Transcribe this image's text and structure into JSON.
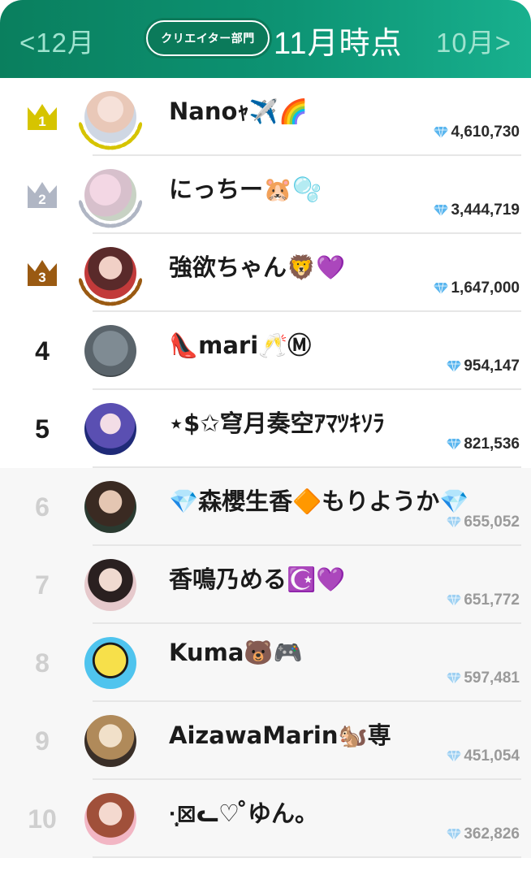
{
  "header": {
    "prev_label": "<12月",
    "category_label": "クリエイター部門",
    "current_label": "11月時点",
    "next_label": "10月>"
  },
  "colors": {
    "header_start": "#0a7f5e",
    "header_end": "#18b08e",
    "gold": "#d6c400",
    "silver": "#b0b6c4",
    "bronze": "#9a5a12",
    "gem": "#5ab6ef"
  },
  "rankings": [
    {
      "rank": "1",
      "name": "Nanoｬ✈️🌈",
      "score": "4,610,730",
      "medal": "gold",
      "avatar_icon": "avatar-photo-1"
    },
    {
      "rank": "2",
      "name": "にっちー🐹🫧",
      "score": "3,444,719",
      "medal": "silver",
      "avatar_icon": "avatar-photo-2"
    },
    {
      "rank": "3",
      "name": "強欲ちゃん🦁💜",
      "score": "1,647,000",
      "medal": "bronze",
      "avatar_icon": "avatar-photo-3"
    },
    {
      "rank": "4",
      "name": "👠mari🥂Ⓜ",
      "score": "954,147",
      "medal": "",
      "avatar_icon": "avatar-cat"
    },
    {
      "rank": "5",
      "name": "⋆$✩穹月奏空ｱﾏﾂｷｿﾗ",
      "score": "821,536",
      "medal": "",
      "avatar_icon": "avatar-illustration"
    },
    {
      "rank": "6",
      "name": "💎森櫻生香🔶もりようか💎",
      "score": "655,052",
      "medal": "",
      "avatar_icon": "avatar-photo-6"
    },
    {
      "rank": "7",
      "name": "香鳴乃める☪️💜",
      "score": "651,772",
      "medal": "",
      "avatar_icon": "avatar-photo-7"
    },
    {
      "rank": "8",
      "name": "Kuma🐻🎮",
      "score": "597,481",
      "medal": "",
      "avatar_icon": "avatar-bear"
    },
    {
      "rank": "9",
      "name": "AizawaMarin🐿️専",
      "score": "451,054",
      "medal": "",
      "avatar_icon": "avatar-anime"
    },
    {
      "rank": "10",
      "name": "·̩͙⊠ᓚ♡ ̊ゆん。",
      "score": "362,826",
      "medal": "",
      "avatar_icon": "avatar-anime-2"
    }
  ]
}
